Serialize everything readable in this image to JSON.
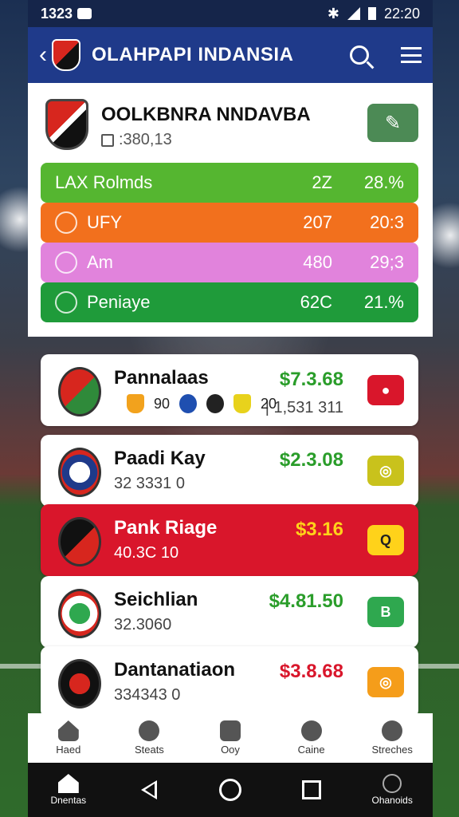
{
  "status_bar": {
    "time_left": "1323",
    "time_right": "22:20"
  },
  "app_bar": {
    "back_symbol": "‹",
    "title": "OLAHPAPI INDANSIA",
    "icons": [
      "search-icon",
      "menu-icon"
    ]
  },
  "club": {
    "name": "OOLKBNRA NNDAVBA",
    "sub": ":380,13",
    "edit_symbol": "✎"
  },
  "stats": [
    {
      "label": "LAX  Rolmds",
      "v1": "2Z",
      "v2": "28.%",
      "color": "#55b630",
      "icon": "none"
    },
    {
      "label": "UFY",
      "v1": "207",
      "v2": "20:3",
      "color": "#f2701d",
      "icon": "target-icon"
    },
    {
      "label": "Am",
      "v1": "480",
      "v2": "29;3",
      "color": "#e183dc",
      "icon": "plane-icon"
    },
    {
      "label": "Peniaye",
      "v1": "62C",
      "v2": "21.%",
      "color": "#1f9b3a",
      "icon": "flag-icon"
    }
  ],
  "list": [
    {
      "name": "Pannalaas",
      "sub": "",
      "chips_left": "90",
      "chips_right": "20",
      "price": "$7.3.68",
      "sub2": "| 1,531 311",
      "btn_color": "#d9162b",
      "btn_symbol": "●",
      "style": "white"
    },
    {
      "name": "Paadi Kay",
      "sub": "32 3331 0",
      "price": "$2.3.08",
      "sub2": "",
      "btn_color": "#c9c21c",
      "btn_symbol": "◎",
      "style": "white"
    },
    {
      "name": "Pank Riage",
      "sub": "40.3C 10",
      "price": "$3.16",
      "sub2": "",
      "btn_color": "#ffd21a",
      "btn_symbol": "Q",
      "style": "red"
    },
    {
      "name": "Seichlian",
      "sub": "32.3060",
      "price": "$4.81.50",
      "sub2": "",
      "btn_color": "#2fa84f",
      "btn_symbol": "B",
      "style": "white"
    },
    {
      "name": "Dantanatiaon",
      "sub": "334343 0",
      "price": "$3.8.68",
      "sub2": "",
      "btn_color": "#f59d1a",
      "btn_symbol": "◎",
      "style": "white",
      "price_color": "#d9162b"
    }
  ],
  "tabs": [
    {
      "label": "Haed",
      "icon": "home-icon"
    },
    {
      "label": "Steats",
      "icon": "chat-icon"
    },
    {
      "label": "Ooy",
      "icon": "pen-icon"
    },
    {
      "label": "Caine",
      "icon": "ball-icon"
    },
    {
      "label": "Streches",
      "icon": "user-icon"
    }
  ],
  "nav": {
    "left_label": "Dnentas",
    "right_label": "Ohanoids"
  }
}
